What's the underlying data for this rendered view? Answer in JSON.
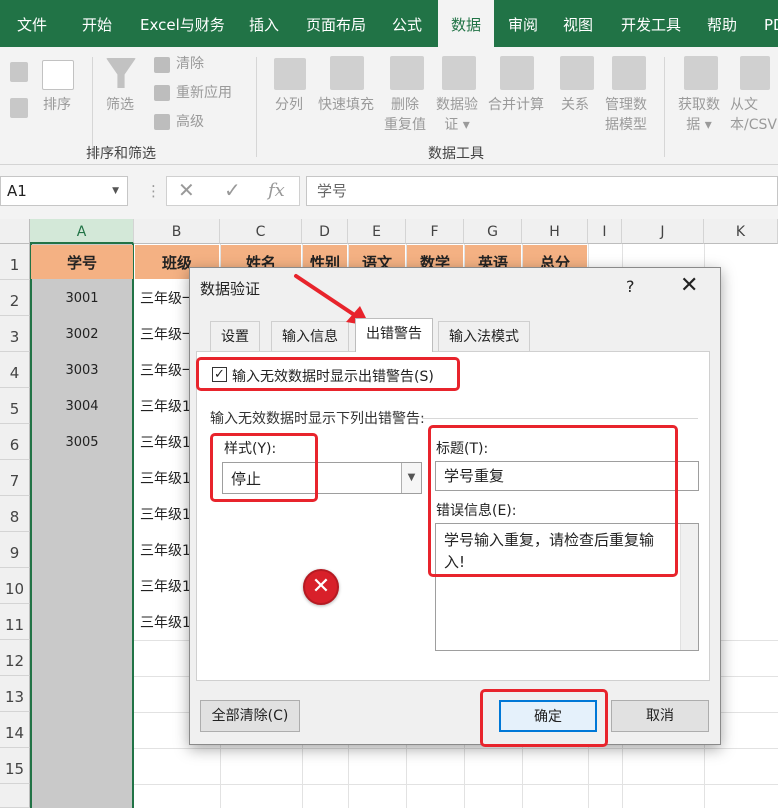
{
  "ribbon_tabs": [
    "文件",
    "开始",
    "Excel与财务",
    "插入",
    "页面布局",
    "公式",
    "数据",
    "审阅",
    "视图",
    "开发工具",
    "帮助",
    "PD"
  ],
  "ribbon": {
    "sort_label": "排序",
    "filter_label": "筛选",
    "clear_label": "清除",
    "reapply_label": "重新应用",
    "advanced_label": "高级",
    "group_sort_filter": "排序和筛选",
    "split_label": "分列",
    "flash_fill_label": "快速填充",
    "remove_dup_label": "删除\n重复值",
    "validation_label": "数据验\n证 ▾",
    "consolidate_label": "合并计算",
    "relations_label": "关系",
    "data_model_label": "管理数\n据模型",
    "group_data_tools": "数据工具",
    "get_data_label": "获取数\n据 ▾",
    "from_text_label": "从文\n本/CSV"
  },
  "formula_bar": {
    "name_box": "A1",
    "fx": "fx",
    "content": "学号"
  },
  "columns": [
    "A",
    "B",
    "C",
    "D",
    "E",
    "F",
    "G",
    "H",
    "I",
    "J",
    "K"
  ],
  "rows": [
    "1",
    "2",
    "3",
    "4",
    "5",
    "6",
    "7",
    "8",
    "9",
    "10",
    "11",
    "12",
    "13",
    "14",
    "15"
  ],
  "header_row": [
    "学号",
    "班级",
    "姓名",
    "性别",
    "语文",
    "数学",
    "英语",
    "总分"
  ],
  "ids": [
    "3001",
    "3002",
    "3003",
    "3004",
    "3005"
  ],
  "class_cells": [
    "三年级一",
    "三年级一",
    "三年级一",
    "三年级1",
    "三年级1",
    "三年级1",
    "三年级1",
    "三年级1",
    "三年级1",
    "三年级1"
  ],
  "dialog": {
    "title": "数据验证",
    "help": "?",
    "close": "✕",
    "tabs": [
      "设置",
      "输入信息",
      "出错警告",
      "输入法模式"
    ],
    "show_alert_label": "输入无效数据时显示出错警告(S)",
    "section_label": "输入无效数据时显示下列出错警告:",
    "style_label": "样式(Y):",
    "style_value": "停止",
    "title_label": "标题(T):",
    "title_value": "学号重复",
    "error_label": "错误信息(E):",
    "error_value": "学号输入重复，请检查后重复输入!",
    "clear_all": "全部清除(C)",
    "ok": "确定",
    "cancel": "取消"
  },
  "colors": {
    "excel_green": "#217346",
    "header_fill": "#f4b183",
    "highlight_red": "#e8242c",
    "stop_icon": "#d8202a"
  }
}
